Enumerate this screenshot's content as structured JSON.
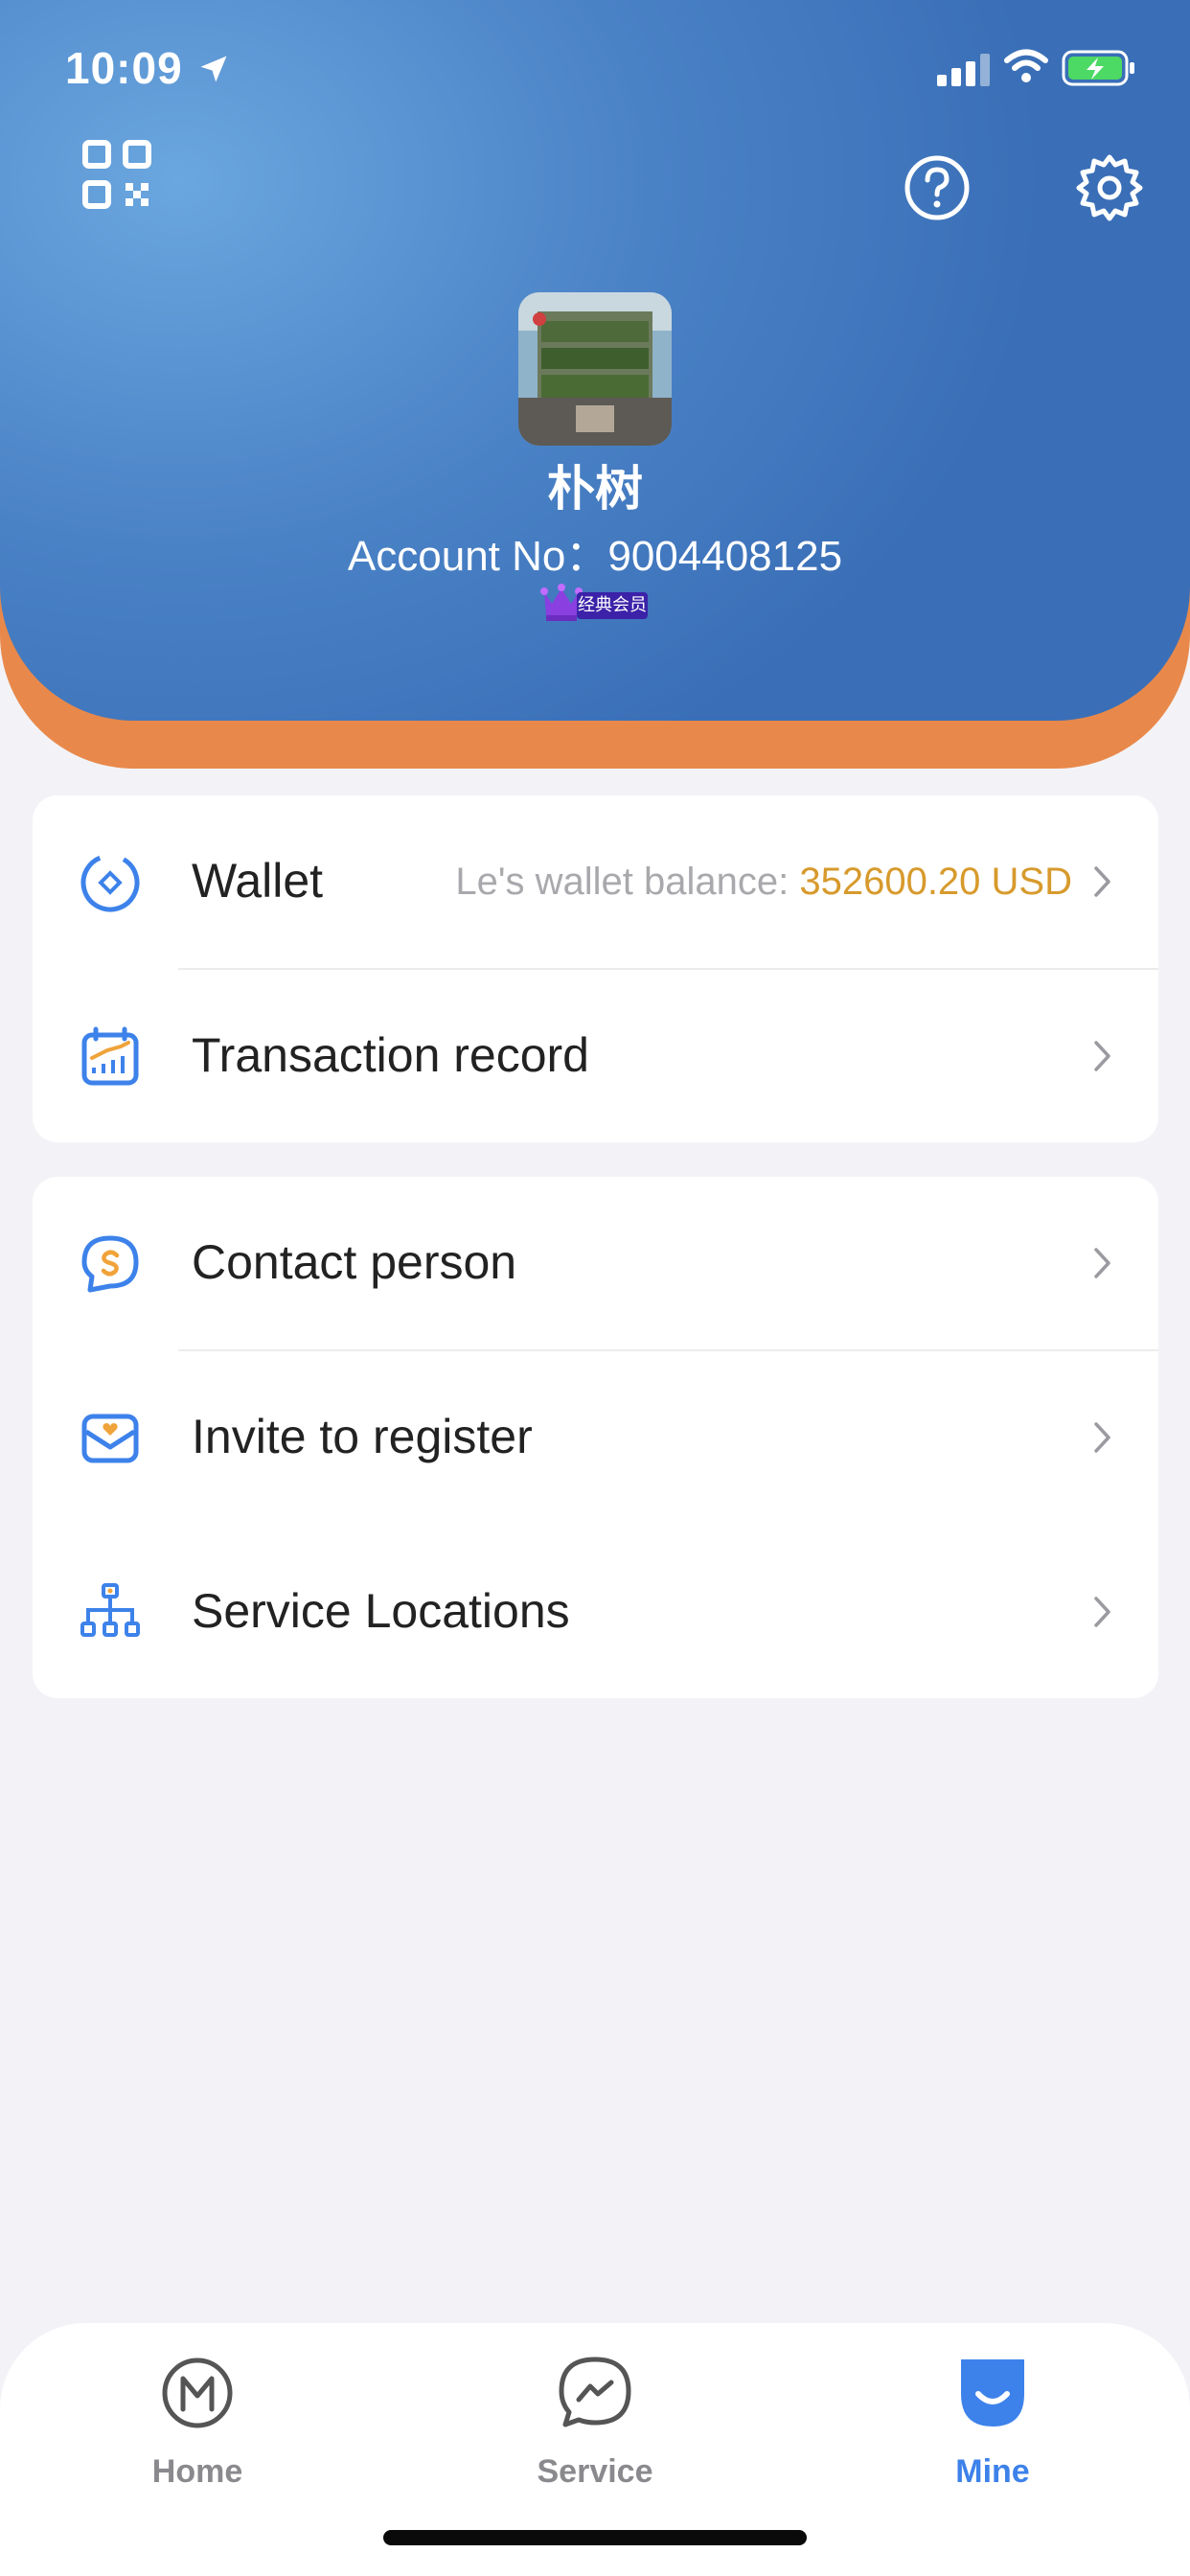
{
  "status_bar": {
    "time": "10:09"
  },
  "profile": {
    "name": "朴树",
    "account": "Account No：9004408125",
    "badge": "经典会员"
  },
  "icons": {
    "qr": "qr-code-icon",
    "help": "help-circle-icon",
    "settings": "gear-icon"
  },
  "menu_group_1": [
    {
      "label": "Wallet",
      "icon": "wallet-icon",
      "sub_label": "Le's wallet balance: ",
      "sub_value": "352600.20 USD"
    },
    {
      "label": "Transaction record",
      "icon": "transaction-chart-icon"
    }
  ],
  "menu_group_2": [
    {
      "label": "Contact person",
      "icon": "contact-bubble-icon"
    },
    {
      "label": "Invite to register",
      "icon": "invite-envelope-icon"
    },
    {
      "label": "Service Locations",
      "icon": "location-tree-icon"
    }
  ],
  "tabs": [
    {
      "label": "Home",
      "icon": "home-m-icon",
      "active": false
    },
    {
      "label": "Service",
      "icon": "chat-service-icon",
      "active": false
    },
    {
      "label": "Mine",
      "icon": "mine-smile-icon",
      "active": true
    }
  ],
  "colors": {
    "header_blue": "#4a82c6",
    "header_orange": "#e8894b",
    "accent_blue": "#3d82ea",
    "amount_gold": "#d79a2c"
  }
}
